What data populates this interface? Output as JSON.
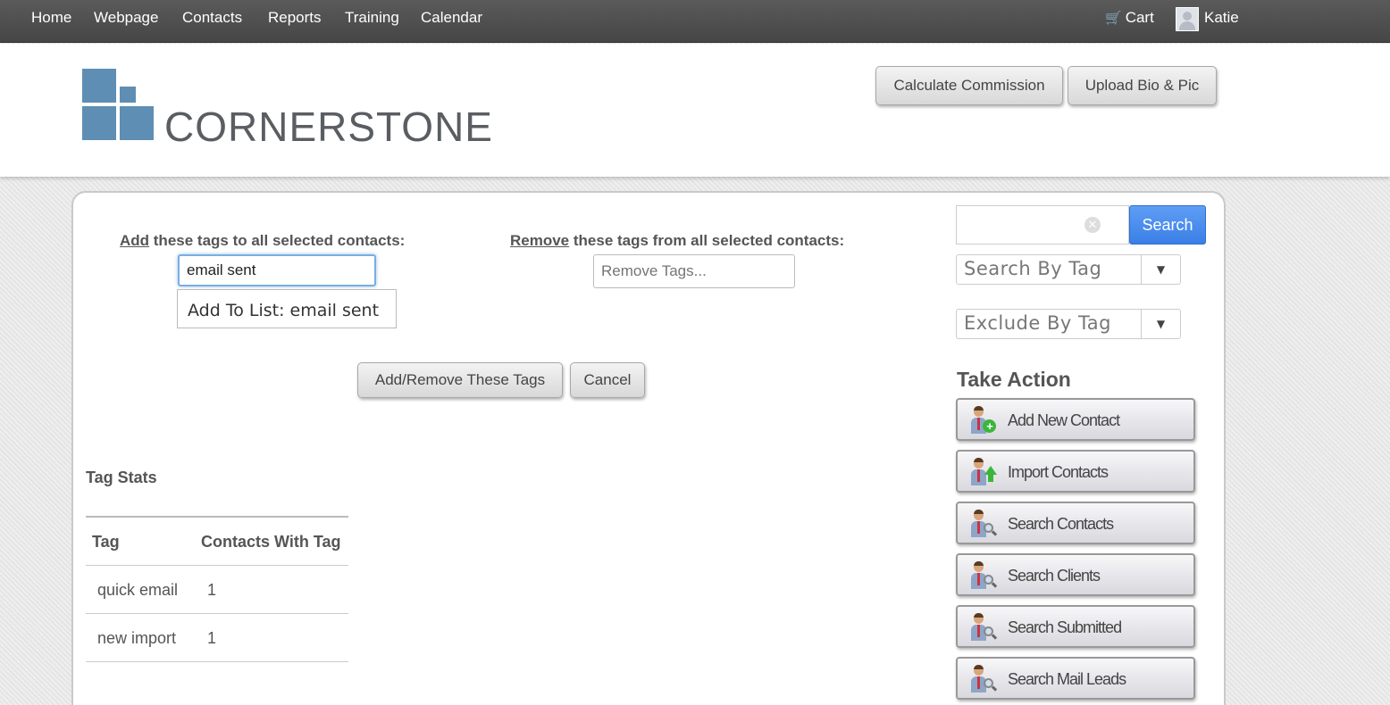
{
  "nav": {
    "items": [
      "Home",
      "Webpage",
      "Contacts",
      "Reports",
      "Training",
      "Calendar"
    ],
    "cart": "Cart",
    "user": "Katie"
  },
  "header": {
    "logo_text": "CORNERSTONE",
    "calc_button": "Calculate Commission",
    "upload_button": "Upload Bio & Pic"
  },
  "tags": {
    "add_label_link": "Add",
    "add_label_rest": " these tags to all selected contacts:",
    "add_value": "email sent",
    "suggestion": "Add To List: email sent",
    "remove_label_link": "Remove",
    "remove_label_rest": " these tags from all selected contacts:",
    "remove_placeholder": "Remove Tags...",
    "submit_button": "Add/Remove These Tags",
    "cancel_button": "Cancel"
  },
  "stats": {
    "title": "Tag Stats",
    "col_tag": "Tag",
    "col_count": "Contacts With Tag",
    "rows": [
      {
        "tag": "quick email",
        "count": "1"
      },
      {
        "tag": "new import",
        "count": "1"
      }
    ]
  },
  "sidebar": {
    "search_button": "Search",
    "search_by_tag": "Search By Tag",
    "exclude_by_tag": "Exclude By Tag",
    "take_action": "Take Action",
    "actions": [
      "Add New Contact",
      "Import Contacts",
      "Search Contacts",
      "Search Clients",
      "Search Submitted",
      "Search Mail Leads"
    ]
  }
}
